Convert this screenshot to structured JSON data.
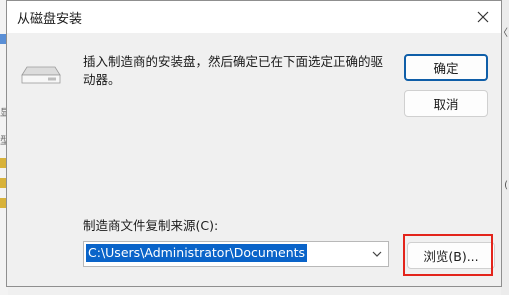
{
  "dialog": {
    "title": "从磁盘安装",
    "description": "插入制造商的安装盘，然后确定已在下面选定正确的驱动器。",
    "ok_label": "确定",
    "cancel_label": "取消",
    "source_label": "制造商文件复制来源(C):",
    "source_value": "C:\\Users\\Administrator\\Documents",
    "browse_label": "浏览(B)..."
  },
  "background": {
    "left_text_1": "显",
    "left_text_2": "型"
  },
  "colors": {
    "accent": "#0f5ea8",
    "selection": "#0a64c9",
    "highlight": "#e3241b"
  },
  "icons": {
    "close": "close-icon",
    "disk": "disk-drive-icon",
    "dropdown": "chevron-down-icon"
  }
}
